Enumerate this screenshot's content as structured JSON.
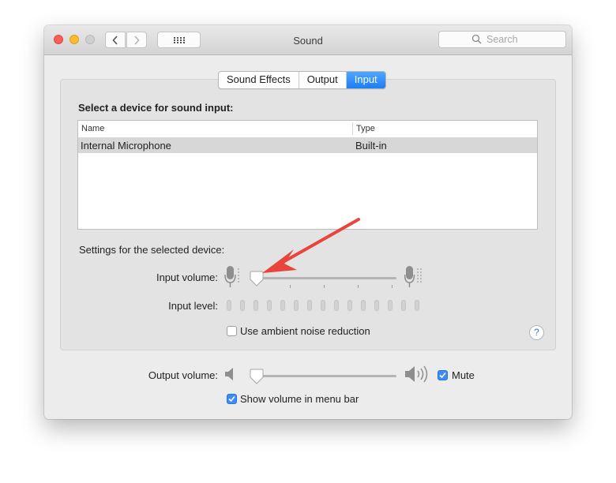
{
  "window": {
    "title": "Sound",
    "search_placeholder": "Search"
  },
  "tabs": [
    {
      "label": "Sound Effects",
      "active": false
    },
    {
      "label": "Output",
      "active": false
    },
    {
      "label": "Input",
      "active": true
    }
  ],
  "input": {
    "heading": "Select a device for sound input:",
    "columns": [
      "Name",
      "Type"
    ],
    "devices": [
      {
        "name": "Internal Microphone",
        "type": "Built-in",
        "selected": true
      }
    ],
    "settings_label": "Settings for the selected device:",
    "volume_label": "Input volume:",
    "volume_level": 0.0,
    "level_label": "Input level:",
    "level_segments": 15,
    "level_active": 0,
    "noise_reduction_label": "Use ambient noise reduction",
    "noise_reduction_checked": false
  },
  "output": {
    "volume_label": "Output volume:",
    "volume_level": 0.0,
    "mute_label": "Mute",
    "mute_checked": true,
    "show_in_menu_label": "Show volume in menu bar",
    "show_in_menu_checked": true
  },
  "help_label": "?",
  "colors": {
    "accent": "#1a7ef5",
    "annotation_arrow": "#e8453c"
  }
}
